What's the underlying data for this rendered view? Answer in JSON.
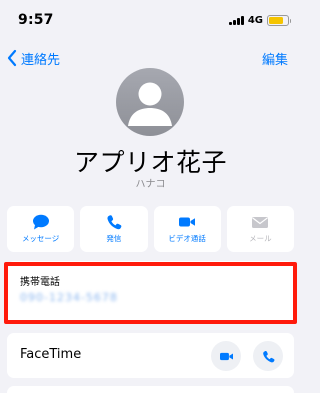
{
  "status_bar": {
    "time": "9:57",
    "network": "4G",
    "battery_level": 0.8,
    "battery_color": "#f5c400"
  },
  "nav": {
    "back_label": "連絡先",
    "back_icon": "chevron-left-icon",
    "edit_label": "編集"
  },
  "contact": {
    "name": "アプリオ花子",
    "reading": "ハナコ",
    "avatar_icon": "person-silhouette-icon"
  },
  "actions": [
    {
      "label": "メッセージ",
      "icon": "message-bubble-icon",
      "enabled": true
    },
    {
      "label": "発信",
      "icon": "phone-icon",
      "enabled": true
    },
    {
      "label": "ビデオ通話",
      "icon": "video-camera-icon",
      "enabled": true
    },
    {
      "label": "メール",
      "icon": "envelope-icon",
      "enabled": false
    }
  ],
  "phone": {
    "label": "携帯電話",
    "number": "090-1234-5678"
  },
  "facetime": {
    "label": "FaceTime",
    "video_icon": "video-camera-icon",
    "audio_icon": "phone-icon"
  },
  "colors": {
    "accent": "#007aff",
    "highlight": "#ff1a0b",
    "background": "#f2f2f7"
  }
}
